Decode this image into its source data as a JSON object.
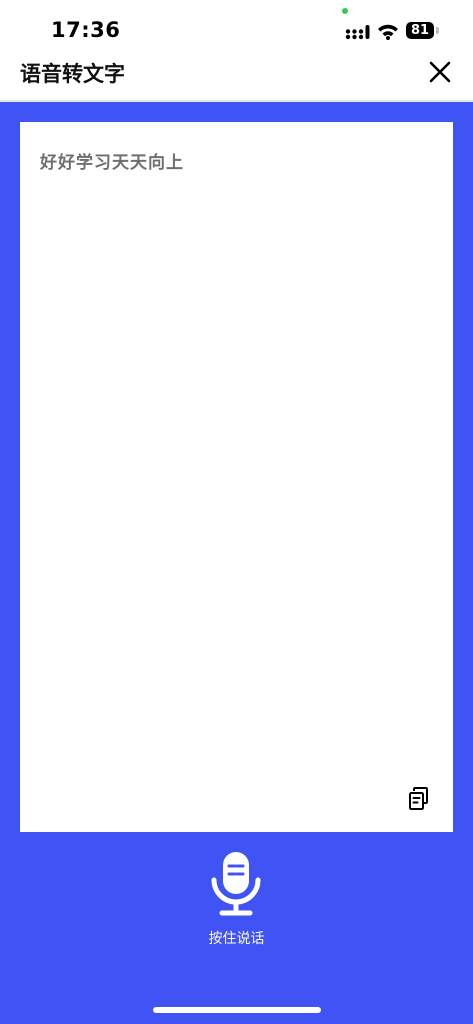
{
  "status_bar": {
    "time": "17:36",
    "battery_level": "81",
    "icons": [
      "camera-indicator-dot",
      "signal-icon",
      "wifi-icon",
      "battery-icon"
    ]
  },
  "header": {
    "title": "语音转文字",
    "close_icon": "close-icon"
  },
  "transcript": {
    "text": "好好学习天天向上",
    "copy_icon": "copy-icon"
  },
  "voice": {
    "mic_icon": "microphone-icon",
    "label": "按住说话"
  },
  "colors": {
    "background_blue": "#4053f4",
    "card": "#ffffff",
    "text_gray": "#6f6f6f"
  }
}
